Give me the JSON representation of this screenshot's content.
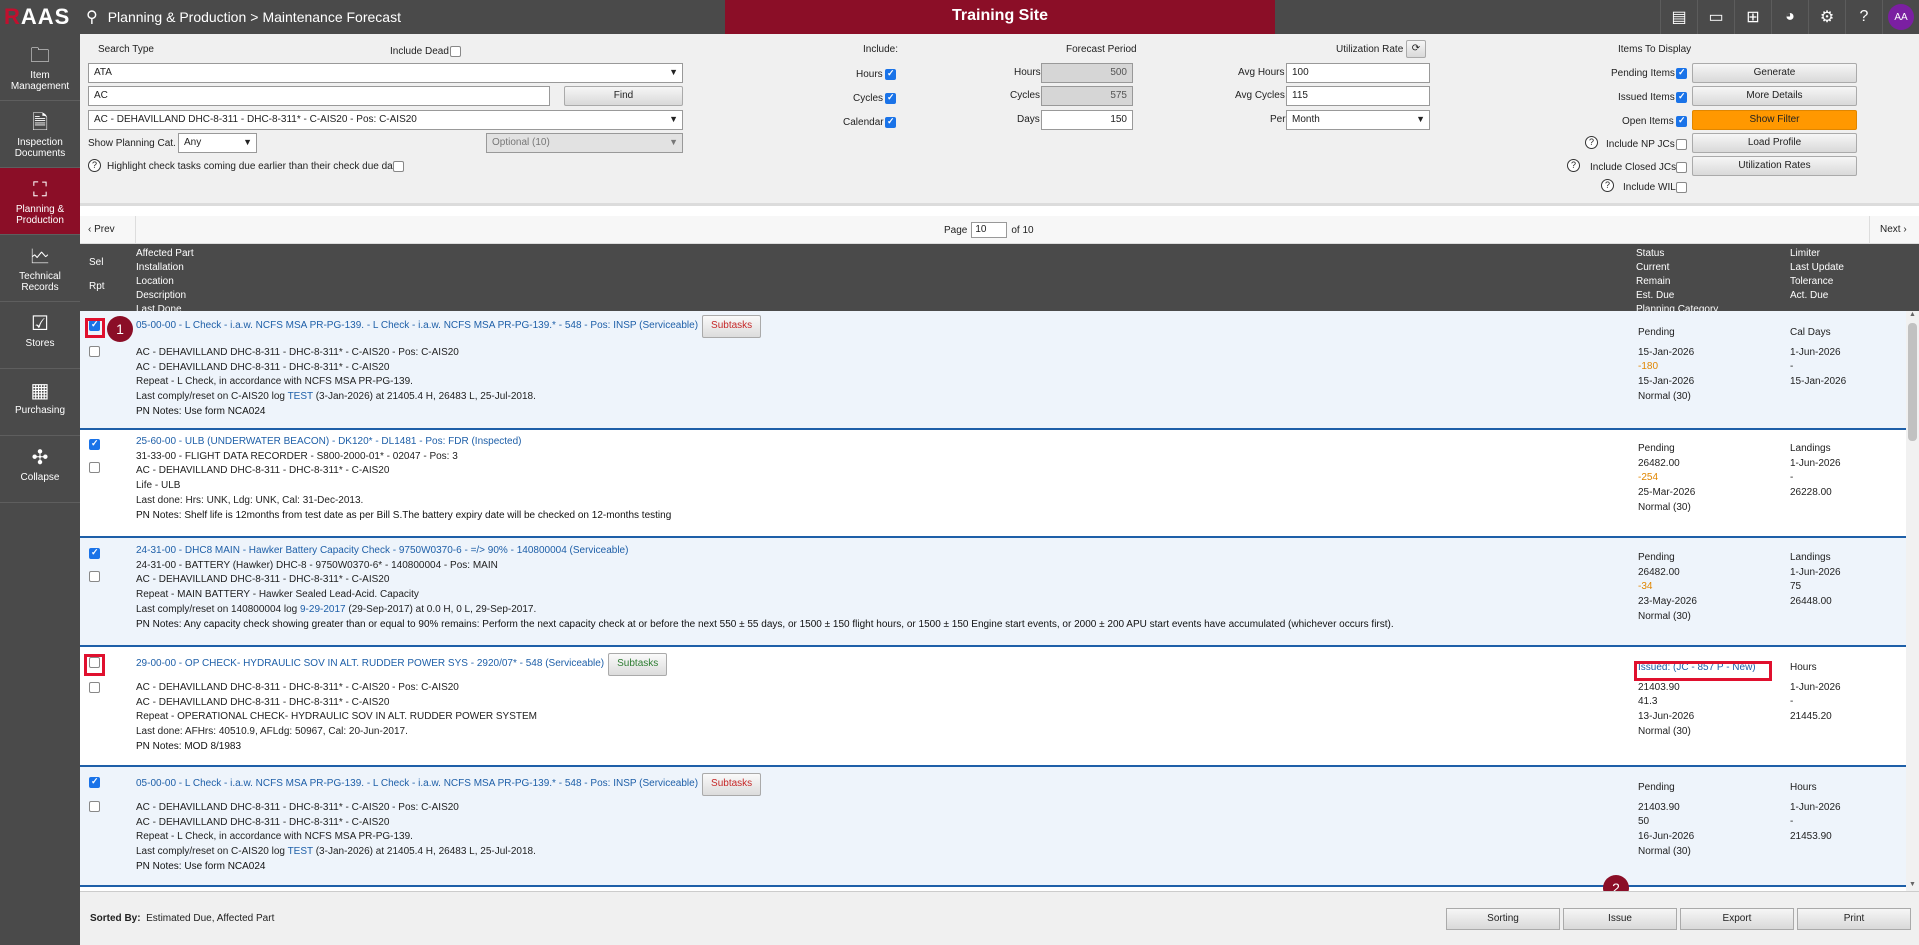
{
  "app": {
    "logo_r": "R",
    "logo_rest": "AAS",
    "breadcrumb_section": "Planning & Production",
    "breadcrumb_sep": ">",
    "breadcrumb_page": "Maintenance Forecast",
    "site_banner": "Training Site",
    "avatar_initials": "AA",
    "top_icons": [
      "contact-card-icon",
      "chat-icon",
      "add-icon",
      "pie-chart-icon",
      "settings-icon",
      "help-icon"
    ]
  },
  "sidebar": {
    "items": [
      {
        "label": "Item Management",
        "icon": "folder-icon",
        "glyph": "📂",
        "active": false
      },
      {
        "label": "Inspection Documents",
        "icon": "document-icon",
        "glyph": "📄",
        "active": false
      },
      {
        "label": "Planning & Production",
        "icon": "network-icon",
        "glyph": "⛓",
        "active": true
      },
      {
        "label": "Technical Records",
        "icon": "chart-document-icon",
        "glyph": "📈",
        "active": false
      },
      {
        "label": "Stores",
        "icon": "clipboard-check-icon",
        "glyph": "📋",
        "active": false
      },
      {
        "label": "Purchasing",
        "icon": "calculator-icon",
        "glyph": "🖩",
        "active": false
      },
      {
        "label": "Collapse",
        "icon": "collapse-icon",
        "glyph": "⤡",
        "active": false
      }
    ]
  },
  "filters": {
    "search_type_label": "Search Type",
    "include_dead_label": "Include Dead",
    "search_type_value": "ATA",
    "search_text_value": "AC",
    "find_label": "Find",
    "aircraft_value": "AC - DEHAVILLAND DHC-8-311 - DHC-8-311* - C-AIS20 - Pos: C-AIS20",
    "show_planning_cat_label": "Show Planning Cat.",
    "planning_cat_value": "Any",
    "optional_value": "Optional (10)",
    "highlight_label": "Highlight check tasks coming due earlier than their check due date",
    "include_label": "Include:",
    "include_hours_label": "Hours",
    "include_cycles_label": "Cycles",
    "include_calendar_label": "Calendar",
    "forecast_period_label": "Forecast Period",
    "fp_hours_label": "Hours",
    "fp_hours_value": "500",
    "fp_cycles_label": "Cycles",
    "fp_cycles_value": "575",
    "fp_days_label": "Days",
    "fp_days_value": "150",
    "utilization_rate_label": "Utilization Rate",
    "avg_hours_label": "Avg Hours",
    "avg_hours_value": "100",
    "avg_cycles_label": "Avg Cycles",
    "avg_cycles_value": "115",
    "per_label": "Per",
    "per_value": "Month",
    "items_to_display_label": "Items To Display",
    "pending_items_label": "Pending Items",
    "issued_items_label": "Issued Items",
    "open_items_label": "Open Items",
    "include_np_jcs_label": "Include NP JCs",
    "include_closed_jcs_label": "Include Closed JCs",
    "include_wil_label": "Include WIL",
    "generate_label": "Generate",
    "more_details_label": "More Details",
    "show_filter_label": "Show Filter",
    "load_profile_label": "Load Profile",
    "utilization_rates_label": "Utilization Rates"
  },
  "pager": {
    "prev_label": "Prev",
    "next_label": "Next",
    "page_label": "Page",
    "page_value": "10",
    "of_label": "of 10"
  },
  "table": {
    "headers": {
      "sel": "Sel",
      "rpt": "Rpt",
      "affected_part": "Affected Part",
      "installation": "Installation",
      "location": "Location",
      "description": "Description",
      "last_done": "Last Done",
      "status": "Status",
      "current": "Current",
      "remain": "Remain",
      "est_due": "Est. Due",
      "planning_category": "Planning Category",
      "limiter": "Limiter",
      "last_update": "Last Update",
      "tolerance": "Tolerance",
      "act_due": "Act. Due"
    },
    "rows": [
      {
        "title": "05-00-00 - L Check - i.a.w. NCFS MSA PR-PG-139. - L Check - i.a.w. NCFS MSA PR-PG-139.* - 548 - Pos: INSP (Serviceable)",
        "subtasks": "Subtasks",
        "line2": "AC - DEHAVILLAND DHC-8-311 - DHC-8-311* - C-AIS20 - Pos: C-AIS20",
        "line3": "AC - DEHAVILLAND DHC-8-311 - DHC-8-311* - C-AIS20",
        "line4": "Repeat - L Check, in accordance with NCFS MSA PR-PG-139.",
        "line5_pre": "Last comply/reset on C-AIS20 log ",
        "line5_link": "TEST",
        "line5_post": " (3-Jan-2026) at 21405.4 H, 26483 L, 25-Jul-2018.",
        "notes": "PN Notes: Use form NCA024",
        "status": "Pending",
        "current": "15-Jan-2026",
        "remain": "-180",
        "est_due": "15-Jan-2026",
        "category": "Normal (30)",
        "limiter": "Cal Days",
        "last_update": "1-Jun-2026",
        "tolerance": "-",
        "act_due": "15-Jan-2026"
      },
      {
        "title": "25-60-00 - ULB (UNDERWATER BEACON) - DK120* - DL1481 - Pos: FDR (Inspected)",
        "line1": "31-33-00 - FLIGHT DATA RECORDER - S800-2000-01* - 02047 - Pos: 3",
        "line2": "AC - DEHAVILLAND DHC-8-311 - DHC-8-311* - C-AIS20",
        "line3": "Life - ULB",
        "line4": "Last done: Hrs: UNK, Ldg: UNK, Cal: 31-Dec-2013.",
        "notes": "PN Notes: Shelf life is 12months from test date as per Bill S.The battery expiry date will be checked on 12-months testing",
        "status": "Pending",
        "current": "26482.00",
        "remain": "-254",
        "est_due": "25-Mar-2026",
        "category": "Normal (30)",
        "limiter": "Landings",
        "last_update": "1-Jun-2026",
        "tolerance": "-",
        "act_due": "26228.00"
      },
      {
        "title": "24-31-00 - DHC8 MAIN - Hawker Battery Capacity Check - 9750W0370-6 - =/> 90% - 140800004 (Serviceable)",
        "line1": "24-31-00 - BATTERY (Hawker) DHC-8 - 9750W0370-6* - 140800004 - Pos: MAIN",
        "line2": "AC - DEHAVILLAND DHC-8-311 - DHC-8-311* - C-AIS20",
        "line3": "Repeat - MAIN BATTERY - Hawker Sealed Lead-Acid. Capacity",
        "line4_pre": "Last comply/reset on 140800004 log ",
        "line4_link": "9-29-2017",
        "line4_post": " (29-Sep-2017) at 0.0 H, 0 L, 29-Sep-2017.",
        "notes": "PN Notes: Any capacity check showing greater than or equal to 90% remains: Perform the next capacity check at or before the next 550 ± 55 days, or 1500 ± 150 flight hours, or 1500 ± 150 Engine start events, or 2000 ± 200 APU start events have accumulated (whichever occurs first).",
        "status": "Pending",
        "current": "26482.00",
        "remain": "-34",
        "est_due": "23-May-2026",
        "category": "Normal (30)",
        "limiter": "Landings",
        "last_update": "1-Jun-2026",
        "tolerance": "75",
        "act_due": "26448.00"
      },
      {
        "title": "29-00-00 - OP CHECK- HYDRAULIC SOV IN ALT. RUDDER POWER SYS - 2920/07* - 548 (Serviceable)",
        "subtasks": "Subtasks",
        "line2": "AC - DEHAVILLAND DHC-8-311 - DHC-8-311* - C-AIS20 - Pos: C-AIS20",
        "line3": "AC - DEHAVILLAND DHC-8-311 - DHC-8-311* - C-AIS20",
        "line4": "Repeat - OPERATIONAL CHECK- HYDRAULIC SOV IN ALT. RUDDER POWER SYSTEM",
        "line5": "Last done: AFHrs: 40510.9, AFLdg: 50967, Cal: 20-Jun-2017.",
        "notes": "PN Notes: MOD 8/1983",
        "status": "Issued: (JC - 857 P - New)",
        "current": "21403.90",
        "remain": "41.3",
        "est_due": "13-Jun-2026",
        "category": "Normal (30)",
        "limiter": "Hours",
        "last_update": "1-Jun-2026",
        "tolerance": "-",
        "act_due": "21445.20"
      },
      {
        "title": "05-00-00 - L Check - i.a.w. NCFS MSA PR-PG-139. - L Check - i.a.w. NCFS MSA PR-PG-139.* - 548 - Pos: INSP (Serviceable)",
        "subtasks": "Subtasks",
        "line2": "AC - DEHAVILLAND DHC-8-311 - DHC-8-311* - C-AIS20 - Pos: C-AIS20",
        "line3": "AC - DEHAVILLAND DHC-8-311 - DHC-8-311* - C-AIS20",
        "line4": "Repeat - L Check, in accordance with NCFS MSA PR-PG-139.",
        "line5_pre": "Last comply/reset on C-AIS20 log ",
        "line5_link": "TEST",
        "line5_post": " (3-Jan-2026) at 21405.4 H, 26483 L, 25-Jul-2018.",
        "notes": "PN Notes: Use form NCA024",
        "status": "Pending",
        "current": "21403.90",
        "remain": "50",
        "est_due": "16-Jun-2026",
        "category": "Normal (30)",
        "limiter": "Hours",
        "last_update": "1-Jun-2026",
        "tolerance": "-",
        "act_due": "21453.90"
      }
    ]
  },
  "markers": {
    "one": "1",
    "two": "2"
  },
  "footer": {
    "sorted_by_label": "Sorted By:",
    "sorted_by_value": "Estimated Due, Affected Part",
    "sorting_label": "Sorting",
    "issue_label": "Issue",
    "export_label": "Export",
    "print_label": "Print"
  },
  "colors": {
    "brand": "#8b0e27",
    "accent_orange": "#ff9800",
    "link": "#1e5fa8",
    "highlight": "#e0102e"
  }
}
